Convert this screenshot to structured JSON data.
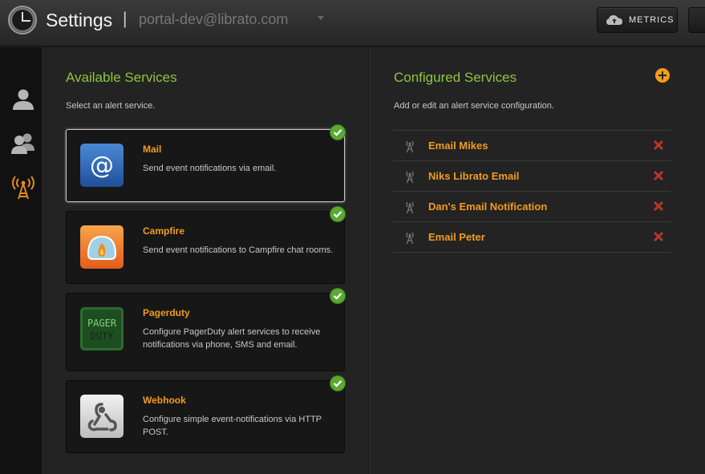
{
  "header": {
    "title": "Settings",
    "separator": "|",
    "account": "portal-dev@librato.com",
    "metrics_label": "METRICS"
  },
  "sidenav": {
    "items": [
      {
        "icon": "user-icon",
        "active": false
      },
      {
        "icon": "users-icon",
        "active": false
      },
      {
        "icon": "antenna-icon",
        "active": true
      }
    ]
  },
  "available": {
    "title": "Available Services",
    "subtitle": "Select an alert service.",
    "services": [
      {
        "name": "Mail",
        "description": "Send event notifications via email.",
        "icon": "mail-at-icon",
        "selected": true
      },
      {
        "name": "Campfire",
        "description": "Send event notifications to Campfire chat rooms.",
        "icon": "campfire-icon",
        "selected": false
      },
      {
        "name": "Pagerduty",
        "description": "Configure PagerDuty alert services to receive notifications via phone, SMS and email.",
        "icon": "pagerduty-icon",
        "selected": false
      },
      {
        "name": "Webhook",
        "description": "Configure simple event-notifications via HTTP POST.",
        "icon": "webhook-icon",
        "selected": false
      }
    ]
  },
  "configured": {
    "title": "Configured Services",
    "subtitle": "Add or edit an alert service configuration.",
    "items": [
      {
        "name": "Email Mikes"
      },
      {
        "name": "Niks Librato Email"
      },
      {
        "name": "Dan's Email Notification"
      },
      {
        "name": "Email Peter"
      }
    ]
  },
  "colors": {
    "accent_green": "#8dc63f",
    "service_orange": "#f39b1b",
    "delete_red": "#c0392b"
  }
}
